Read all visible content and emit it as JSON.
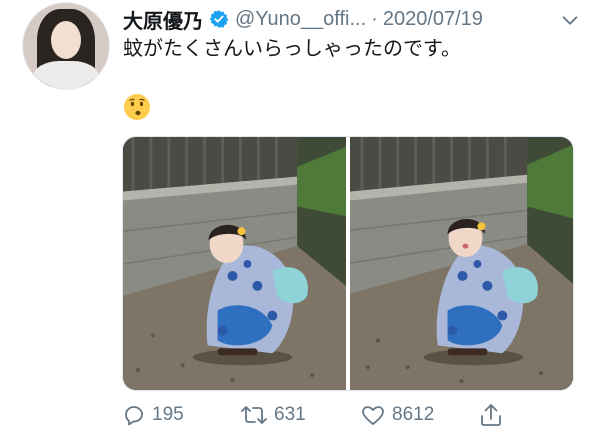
{
  "tweet": {
    "display_name": "大原優乃",
    "handle": "@Yuno__offi...",
    "separator": "·",
    "date": "2020/07/19",
    "text": "蚊がたくさんいらっしゃったのです。",
    "emoji_icon": "kissing-face-icon",
    "verified": true
  },
  "actions": {
    "reply_count": "195",
    "retweet_count": "631",
    "like_count": "8612"
  },
  "colors": {
    "verified_blue": "#1da1f2",
    "muted_text": "#657786",
    "primary_text": "#14171a"
  }
}
